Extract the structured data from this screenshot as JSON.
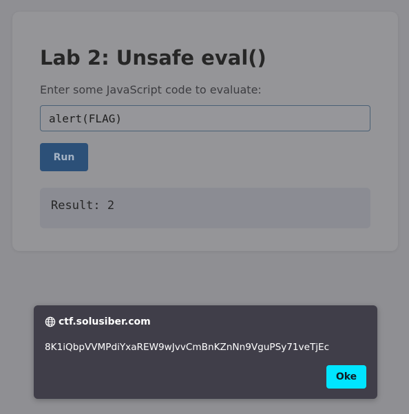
{
  "lab": {
    "title": "Lab 2: Unsafe eval()",
    "prompt": "Enter some JavaScript code to evaluate:",
    "code_value": "alert(FLAG)",
    "run_label": "Run",
    "result_text": "Result: 2"
  },
  "dialog": {
    "origin": "ctf.solusiber.com",
    "message": "8K1iQbpVVMPdiYxaREW9wJvvCmBnKZnNn9VguPSy71veTjEc",
    "ok_label": "Oke",
    "origin_icon": "globe-icon"
  },
  "colors": {
    "overlay_background": "#8f8f93",
    "run_button": "#2c5078",
    "dialog_background": "#403e49",
    "ok_button": "#00e5ff"
  }
}
